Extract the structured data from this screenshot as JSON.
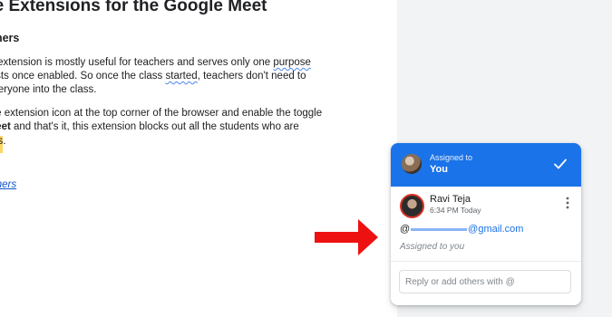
{
  "document": {
    "title": "ne Extensions for the Google Meet",
    "subheading": "chers",
    "paragraph1": {
      "line1_before": "this extension is mostly useful for teachers and serves only one ",
      "line1_squiggle": "purpose",
      "line2_before": "quests once enabled. So once the class ",
      "line2_squiggle": "started",
      "line2_after": ", teachers don't need to",
      "line3": "g everyone into the class."
    },
    "paragraph2": {
      "line1": "n the extension icon at the top corner of the browser and enable the toggle",
      "line2_bold": "e Meet",
      "line2_after": " and that's it, this extension blocks out all the students who are",
      "line3_highlight": "class",
      "line3_after": "."
    },
    "link_text": "chers"
  },
  "comment_card": {
    "assignment": {
      "label": "Assigned to",
      "assignee": "You"
    },
    "author": "Ravi Teja",
    "time": "6:34 PM Today",
    "mention_prefix": "@",
    "mention_domain": "@gmail.com",
    "assigned_note": "Assigned to you",
    "reply": {
      "placeholder": "Reply or add others with @",
      "value": ""
    }
  },
  "colors": {
    "header_blue": "#1a73e8",
    "arrow_red": "#ee1111",
    "highlight_yellow": "#fdd663",
    "link_blue": "#1155cc"
  },
  "icons": {
    "check": "check-icon",
    "more": "more-vert-icon",
    "arrow": "red-arrow-annotation"
  }
}
